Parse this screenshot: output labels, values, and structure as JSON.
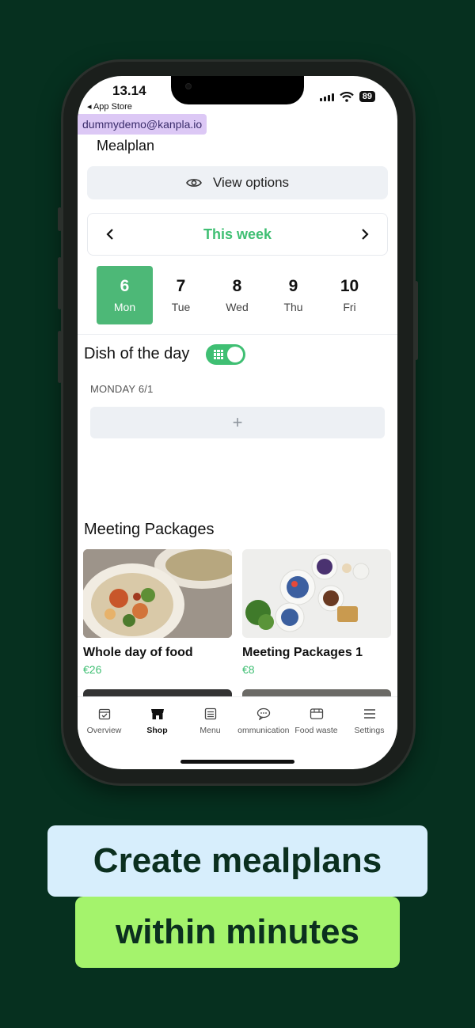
{
  "status": {
    "time": "13.14",
    "back_label": "◂ App Store",
    "battery": "89"
  },
  "account": {
    "email": "dummydemo@kanpla.io"
  },
  "page": {
    "title": "Mealplan"
  },
  "view_options": {
    "label": "View options"
  },
  "week_nav": {
    "label": "This week",
    "prev": "‹",
    "next": "›"
  },
  "days": [
    {
      "num": "6",
      "name": "Mon",
      "active": true
    },
    {
      "num": "7",
      "name": "Tue"
    },
    {
      "num": "8",
      "name": "Wed"
    },
    {
      "num": "9",
      "name": "Thu"
    },
    {
      "num": "10",
      "name": "Fri"
    }
  ],
  "dish_of_day": {
    "title": "Dish of the day",
    "toggle_on": true,
    "day_label": "MONDAY 6/1",
    "add_label": "+"
  },
  "packages": {
    "title": "Meeting Packages",
    "items": [
      {
        "name": "Whole day of food",
        "price": "€26"
      },
      {
        "name": "Meeting Packages 1",
        "price": "€8"
      }
    ]
  },
  "tabbar": [
    {
      "label": "Overview",
      "icon": "calendar-check-icon"
    },
    {
      "label": "Shop",
      "icon": "store-icon",
      "active": true
    },
    {
      "label": "Menu",
      "icon": "list-icon"
    },
    {
      "label": "Communication",
      "icon": "chat-bubble-icon"
    },
    {
      "label": "Food waste",
      "icon": "bin-icon"
    },
    {
      "label": "Settings",
      "icon": "menu-lines-icon"
    }
  ],
  "banner": {
    "line1": "Create mealplans",
    "line2": "within minutes"
  },
  "colors": {
    "accent": "#3fbf73",
    "background": "#06301f",
    "banner1": "#d7eefc",
    "banner2": "#a4f36c"
  }
}
